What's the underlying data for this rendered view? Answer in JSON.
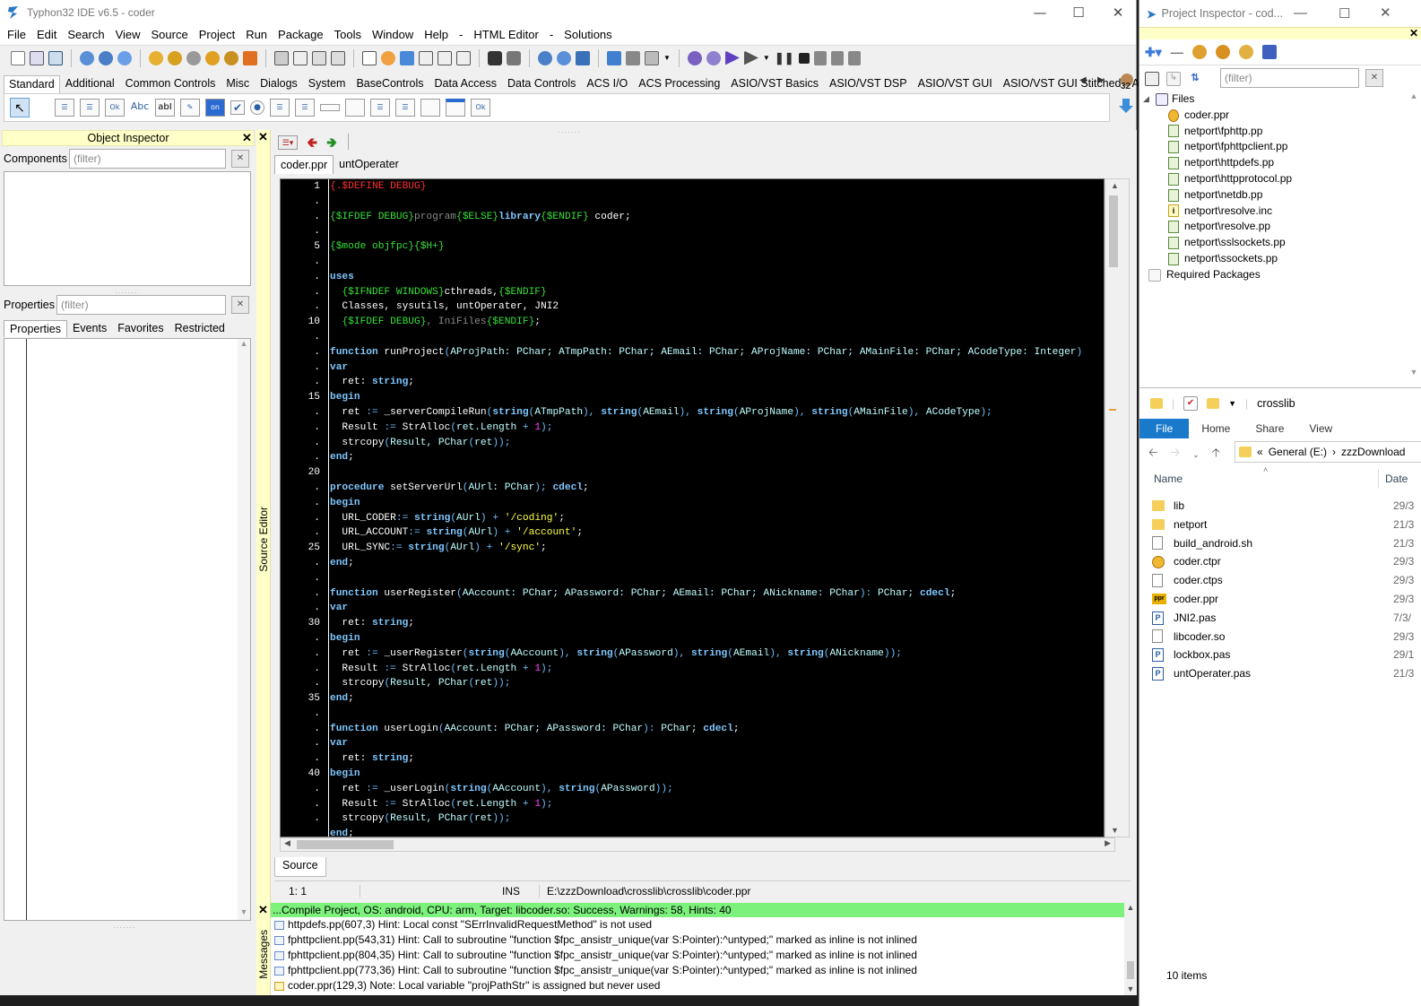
{
  "ide": {
    "title": "Typhon32 IDE v6.5 - coder",
    "menu": [
      "File",
      "Edit",
      "Search",
      "View",
      "Source",
      "Project",
      "Run",
      "Package",
      "Tools",
      "Window",
      "Help",
      "-",
      "HTML Editor",
      "-",
      "Solutions"
    ],
    "palette_tabs": [
      "Standard",
      "Additional",
      "Common Controls",
      "Misc",
      "Dialogs",
      "System",
      "BaseControls",
      "Data Access",
      "Data Controls",
      "ACS I/O",
      "ACS Processing",
      "ASIO/VST Basics",
      "ASIO/VST DSP",
      "ASIO/VST GUI",
      "ASIO/VST GUI Stitched",
      "ASIO,"
    ],
    "palette_badge": "32",
    "palette_labels": {
      "ok": "Ok",
      "abc": "Abc",
      "abi": "abI",
      "on": "on",
      "ok2": "Ok"
    }
  },
  "object_inspector": {
    "title": "Object Inspector",
    "components_label": "Components",
    "components_placeholder": "(filter)",
    "properties_label": "Properties",
    "properties_placeholder": "(filter)",
    "tabs": [
      "Properties",
      "Events",
      "Favorites",
      "Restricted"
    ]
  },
  "source_editor": {
    "side_label": "Source Editor",
    "tabs": [
      "coder.ppr",
      "untOperater"
    ],
    "bottom_tab": "Source",
    "status": {
      "position": "1:  1",
      "mode": "INS",
      "path": "E:\\zzzDownload\\crosslib\\crosslib\\coder.ppr"
    },
    "gutter": [
      "1",
      ".",
      ".",
      ".",
      "5",
      ".",
      ".",
      ".",
      ".",
      "10",
      ".",
      ".",
      ".",
      ".",
      "15",
      ".",
      ".",
      ".",
      ".",
      "20",
      ".",
      ".",
      ".",
      ".",
      "25",
      ".",
      ".",
      ".",
      ".",
      "30",
      ".",
      ".",
      ".",
      ".",
      "35",
      ".",
      ".",
      ".",
      ".",
      "40",
      ".",
      ".",
      "."
    ]
  },
  "code_lines": [
    [
      [
        "dirRed",
        "{.$DEFINE DEBUG}"
      ]
    ],
    [],
    [
      [
        "dir",
        "{$IFDEF DEBUG}"
      ],
      [
        "dim",
        "program"
      ],
      [
        "dir",
        "{$ELSE}"
      ],
      [
        "kw",
        "library"
      ],
      [
        "dir",
        "{$ENDIF}"
      ],
      [
        "fn",
        " coder;"
      ]
    ],
    [],
    [
      [
        "dir",
        "{$mode objfpc}{$H+}"
      ]
    ],
    [],
    [
      [
        "kw",
        "uses"
      ]
    ],
    [
      [
        "fn",
        "  "
      ],
      [
        "dir",
        "{$IFNDEF WINDOWS}"
      ],
      [
        "fn",
        "cthreads,"
      ],
      [
        "dir",
        "{$ENDIF}"
      ]
    ],
    [
      [
        "fn",
        "  Classes, sysutils, untOperater, JNI2"
      ]
    ],
    [
      [
        "fn",
        "  "
      ],
      [
        "dir",
        "{$IFDEF DEBUG}"
      ],
      [
        "dim",
        ", IniFiles"
      ],
      [
        "dir",
        "{$ENDIF}"
      ],
      [
        "fn",
        ";"
      ]
    ],
    [],
    [
      [
        "kw",
        "function"
      ],
      [
        "fn",
        " runProject"
      ],
      [
        "sym",
        "("
      ],
      [
        "ty",
        "AProjPath: PChar; ATmpPath: PChar; AEmail: PChar; AProjName: PChar; AMainFile: PChar; ACodeType: Integer"
      ],
      [
        "sym",
        ")"
      ]
    ],
    [
      [
        "kw",
        "var"
      ]
    ],
    [
      [
        "fn",
        "  ret: "
      ],
      [
        "kw",
        "string"
      ],
      [
        "fn",
        ";"
      ]
    ],
    [
      [
        "kw",
        "begin"
      ]
    ],
    [
      [
        "fn",
        "  ret "
      ],
      [
        "sym",
        ":="
      ],
      [
        "fn",
        " _serverCompileRun"
      ],
      [
        "sym",
        "("
      ],
      [
        "kw",
        "string"
      ],
      [
        "sym",
        "("
      ],
      [
        "ty",
        "ATmpPath"
      ],
      [
        "sym",
        "), "
      ],
      [
        "kw",
        "string"
      ],
      [
        "sym",
        "("
      ],
      [
        "ty",
        "AEmail"
      ],
      [
        "sym",
        "), "
      ],
      [
        "kw",
        "string"
      ],
      [
        "sym",
        "("
      ],
      [
        "ty",
        "AProjName"
      ],
      [
        "sym",
        "), "
      ],
      [
        "kw",
        "string"
      ],
      [
        "sym",
        "("
      ],
      [
        "ty",
        "AMainFile"
      ],
      [
        "sym",
        "), "
      ],
      [
        "ty",
        "ACodeType"
      ],
      [
        "sym",
        ");"
      ]
    ],
    [
      [
        "fn",
        "  Result "
      ],
      [
        "sym",
        ":="
      ],
      [
        "fn",
        " StrAlloc"
      ],
      [
        "sym",
        "("
      ],
      [
        "ty",
        "ret.Length "
      ],
      [
        "sym",
        "+ "
      ],
      [
        "num",
        "1"
      ],
      [
        "sym",
        ");"
      ]
    ],
    [
      [
        "fn",
        "  strcopy"
      ],
      [
        "sym",
        "("
      ],
      [
        "ty",
        "Result, PChar"
      ],
      [
        "sym",
        "("
      ],
      [
        "ty",
        "ret"
      ],
      [
        "sym",
        "));"
      ]
    ],
    [
      [
        "kw",
        "end"
      ],
      [
        "fn",
        ";"
      ]
    ],
    [],
    [
      [
        "kw",
        "procedure"
      ],
      [
        "fn",
        " setServerUrl"
      ],
      [
        "sym",
        "("
      ],
      [
        "ty",
        "AUrl: PChar"
      ],
      [
        "sym",
        ");"
      ],
      [
        "kw",
        " cdecl"
      ],
      [
        "fn",
        ";"
      ]
    ],
    [
      [
        "kw",
        "begin"
      ]
    ],
    [
      [
        "fn",
        "  URL_CODER"
      ],
      [
        "sym",
        ":= "
      ],
      [
        "kw",
        "string"
      ],
      [
        "sym",
        "("
      ],
      [
        "ty",
        "AUrl"
      ],
      [
        "sym",
        ") + "
      ],
      [
        "str",
        "'/coding'"
      ],
      [
        "fn",
        ";"
      ]
    ],
    [
      [
        "fn",
        "  URL_ACCOUNT"
      ],
      [
        "sym",
        ":= "
      ],
      [
        "kw",
        "string"
      ],
      [
        "sym",
        "("
      ],
      [
        "ty",
        "AUrl"
      ],
      [
        "sym",
        ") + "
      ],
      [
        "str",
        "'/account'"
      ],
      [
        "fn",
        ";"
      ]
    ],
    [
      [
        "fn",
        "  URL_SYNC"
      ],
      [
        "sym",
        ":= "
      ],
      [
        "kw",
        "string"
      ],
      [
        "sym",
        "("
      ],
      [
        "ty",
        "AUrl"
      ],
      [
        "sym",
        ") + "
      ],
      [
        "str",
        "'/sync'"
      ],
      [
        "fn",
        ";"
      ]
    ],
    [
      [
        "kw",
        "end"
      ],
      [
        "fn",
        ";"
      ]
    ],
    [],
    [
      [
        "kw",
        "function"
      ],
      [
        "fn",
        " userRegister"
      ],
      [
        "sym",
        "("
      ],
      [
        "ty",
        "AAccount: PChar; APassword: PChar; AEmail: PChar; ANickname: PChar"
      ],
      [
        "sym",
        "):"
      ],
      [
        "ty",
        " PChar;"
      ],
      [
        "kw",
        " cdecl"
      ],
      [
        "fn",
        ";"
      ]
    ],
    [
      [
        "kw",
        "var"
      ]
    ],
    [
      [
        "fn",
        "  ret: "
      ],
      [
        "kw",
        "string"
      ],
      [
        "fn",
        ";"
      ]
    ],
    [
      [
        "kw",
        "begin"
      ]
    ],
    [
      [
        "fn",
        "  ret "
      ],
      [
        "sym",
        ":="
      ],
      [
        "fn",
        " _userRegister"
      ],
      [
        "sym",
        "("
      ],
      [
        "kw",
        "string"
      ],
      [
        "sym",
        "("
      ],
      [
        "ty",
        "AAccount"
      ],
      [
        "sym",
        "), "
      ],
      [
        "kw",
        "string"
      ],
      [
        "sym",
        "("
      ],
      [
        "ty",
        "APassword"
      ],
      [
        "sym",
        "), "
      ],
      [
        "kw",
        "string"
      ],
      [
        "sym",
        "("
      ],
      [
        "ty",
        "AEmail"
      ],
      [
        "sym",
        "), "
      ],
      [
        "kw",
        "string"
      ],
      [
        "sym",
        "("
      ],
      [
        "ty",
        "ANickname"
      ],
      [
        "sym",
        "));"
      ]
    ],
    [
      [
        "fn",
        "  Result "
      ],
      [
        "sym",
        ":="
      ],
      [
        "fn",
        " StrAlloc"
      ],
      [
        "sym",
        "("
      ],
      [
        "ty",
        "ret.Length "
      ],
      [
        "sym",
        "+ "
      ],
      [
        "num",
        "1"
      ],
      [
        "sym",
        ");"
      ]
    ],
    [
      [
        "fn",
        "  strcopy"
      ],
      [
        "sym",
        "("
      ],
      [
        "ty",
        "Result, PChar"
      ],
      [
        "sym",
        "("
      ],
      [
        "ty",
        "ret"
      ],
      [
        "sym",
        "));"
      ]
    ],
    [
      [
        "kw",
        "end"
      ],
      [
        "fn",
        ";"
      ]
    ],
    [],
    [
      [
        "kw",
        "function"
      ],
      [
        "fn",
        " userLogin"
      ],
      [
        "sym",
        "("
      ],
      [
        "ty",
        "AAccount: PChar; APassword: PChar"
      ],
      [
        "sym",
        "):"
      ],
      [
        "ty",
        " PChar;"
      ],
      [
        "kw",
        " cdecl"
      ],
      [
        "fn",
        ";"
      ]
    ],
    [
      [
        "kw",
        "var"
      ]
    ],
    [
      [
        "fn",
        "  ret: "
      ],
      [
        "kw",
        "string"
      ],
      [
        "fn",
        ";"
      ]
    ],
    [
      [
        "kw",
        "begin"
      ]
    ],
    [
      [
        "fn",
        "  ret "
      ],
      [
        "sym",
        ":="
      ],
      [
        "fn",
        " _userLogin"
      ],
      [
        "sym",
        "("
      ],
      [
        "kw",
        "string"
      ],
      [
        "sym",
        "("
      ],
      [
        "ty",
        "AAccount"
      ],
      [
        "sym",
        "), "
      ],
      [
        "kw",
        "string"
      ],
      [
        "sym",
        "("
      ],
      [
        "ty",
        "APassword"
      ],
      [
        "sym",
        "));"
      ]
    ],
    [
      [
        "fn",
        "  Result "
      ],
      [
        "sym",
        ":="
      ],
      [
        "fn",
        " StrAlloc"
      ],
      [
        "sym",
        "("
      ],
      [
        "ty",
        "ret.Length "
      ],
      [
        "sym",
        "+ "
      ],
      [
        "num",
        "1"
      ],
      [
        "sym",
        ");"
      ]
    ],
    [
      [
        "fn",
        "  strcopy"
      ],
      [
        "sym",
        "("
      ],
      [
        "ty",
        "Result, PChar"
      ],
      [
        "sym",
        "("
      ],
      [
        "ty",
        "ret"
      ],
      [
        "sym",
        "));"
      ]
    ],
    [
      [
        "kw",
        "end"
      ],
      [
        "fn",
        ";"
      ]
    ]
  ],
  "messages": {
    "side_label": "Messages",
    "header": "...Compile Project, OS: android, CPU: arm, Target: libcoder.so: Success, Warnings: 58, Hints: 40",
    "lines": [
      "httpdefs.pp(607,3) Hint: Local const \"SErrInvalidRequestMethod\" is not used",
      "fphttpclient.pp(543,31) Hint: Call to subroutine \"function $fpc_ansistr_unique(var S:Pointer):^untyped;\" marked as inline is not inlined",
      "fphttpclient.pp(804,35) Hint: Call to subroutine \"function $fpc_ansistr_unique(var S:Pointer):^untyped;\" marked as inline is not inlined",
      "fphttpclient.pp(773,36) Hint: Call to subroutine \"function $fpc_ansistr_unique(var S:Pointer):^untyped;\" marked as inline is not inlined",
      "coder.ppr(129,3) Note: Local variable \"projPathStr\" is assigned but never used"
    ]
  },
  "project_inspector": {
    "title": "Project Inspector - cod...",
    "filter_placeholder": "(filter)",
    "root": "Files",
    "files": [
      "coder.ppr",
      "netport\\fphttp.pp",
      "netport\\fphttpclient.pp",
      "netport\\httpdefs.pp",
      "netport\\httpprotocol.pp",
      "netport\\netdb.pp",
      "netport\\resolve.inc",
      "netport\\resolve.pp",
      "netport\\sslsockets.pp",
      "netport\\ssockets.pp"
    ],
    "required": "Required Packages"
  },
  "explorer": {
    "title": "crosslib",
    "ribbon_tabs": [
      "File",
      "Home",
      "Share",
      "View"
    ],
    "breadcrumb": [
      "«",
      "General (E:)",
      "›",
      "zzzDownload"
    ],
    "col_name": "Name",
    "col_date": "Date",
    "items": [
      {
        "name": "lib",
        "date": "29/3",
        "kind": "folder"
      },
      {
        "name": "netport",
        "date": "21/3",
        "kind": "folder"
      },
      {
        "name": "build_android.sh",
        "date": "21/3",
        "kind": "file"
      },
      {
        "name": "coder.ctpr",
        "date": "29/3",
        "kind": "ctpr"
      },
      {
        "name": "coder.ctps",
        "date": "29/3",
        "kind": "file"
      },
      {
        "name": "coder.ppr",
        "date": "29/3",
        "kind": "ppr"
      },
      {
        "name": "JNI2.pas",
        "date": "7/3/",
        "kind": "pas"
      },
      {
        "name": "libcoder.so",
        "date": "29/3",
        "kind": "file"
      },
      {
        "name": "lockbox.pas",
        "date": "29/1",
        "kind": "pas"
      },
      {
        "name": "untOperater.pas",
        "date": "21/3",
        "kind": "pas"
      }
    ],
    "status": "10 items"
  }
}
